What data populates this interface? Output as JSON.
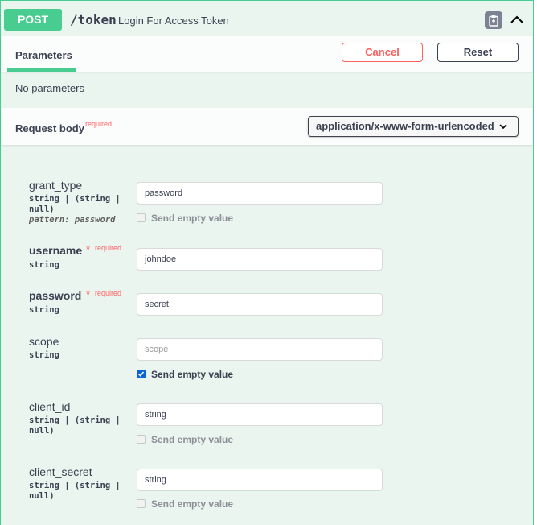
{
  "operation": {
    "method": "POST",
    "path": "/token",
    "summary": "Login For Access Token"
  },
  "parameters": {
    "tab_label": "Parameters",
    "cancel_label": "Cancel",
    "reset_label": "Reset",
    "empty_text": "No parameters"
  },
  "request_body": {
    "title": "Request body",
    "required_label": "required",
    "content_type": "application/x-www-form-urlencoded"
  },
  "fields": {
    "grant_type": {
      "name": "grant_type",
      "type": "string | (string |\nnull)",
      "pattern": "pattern: password",
      "value": "password",
      "send_empty_label": "Send empty value",
      "send_empty_checked": false
    },
    "username": {
      "name": "username",
      "star": "*",
      "required": "required",
      "type": "string",
      "value": "johndoe"
    },
    "password": {
      "name": "password",
      "star": "*",
      "required": "required",
      "type": "string",
      "value": "secret"
    },
    "scope": {
      "name": "scope",
      "type": "string",
      "placeholder": "scope",
      "send_empty_label": "Send empty value",
      "send_empty_checked": true
    },
    "client_id": {
      "name": "client_id",
      "type": "string | (string |\nnull)",
      "value": "string",
      "send_empty_label": "Send empty value",
      "send_empty_checked": false
    },
    "client_secret": {
      "name": "client_secret",
      "type": "string | (string |\nnull)",
      "value": "string",
      "send_empty_label": "Send empty value",
      "send_empty_checked": false
    }
  },
  "icons": {
    "copy": "clipboard-icon",
    "collapse": "chevron-up-icon",
    "dropdown": "chevron-down-icon",
    "check": "checkmark-icon"
  },
  "colors": {
    "post_green": "#49cc90",
    "post_bg": "#eaf5f0",
    "danger": "#ff6060",
    "text": "#3b4151",
    "checkbox_blue": "#0a66d8"
  }
}
